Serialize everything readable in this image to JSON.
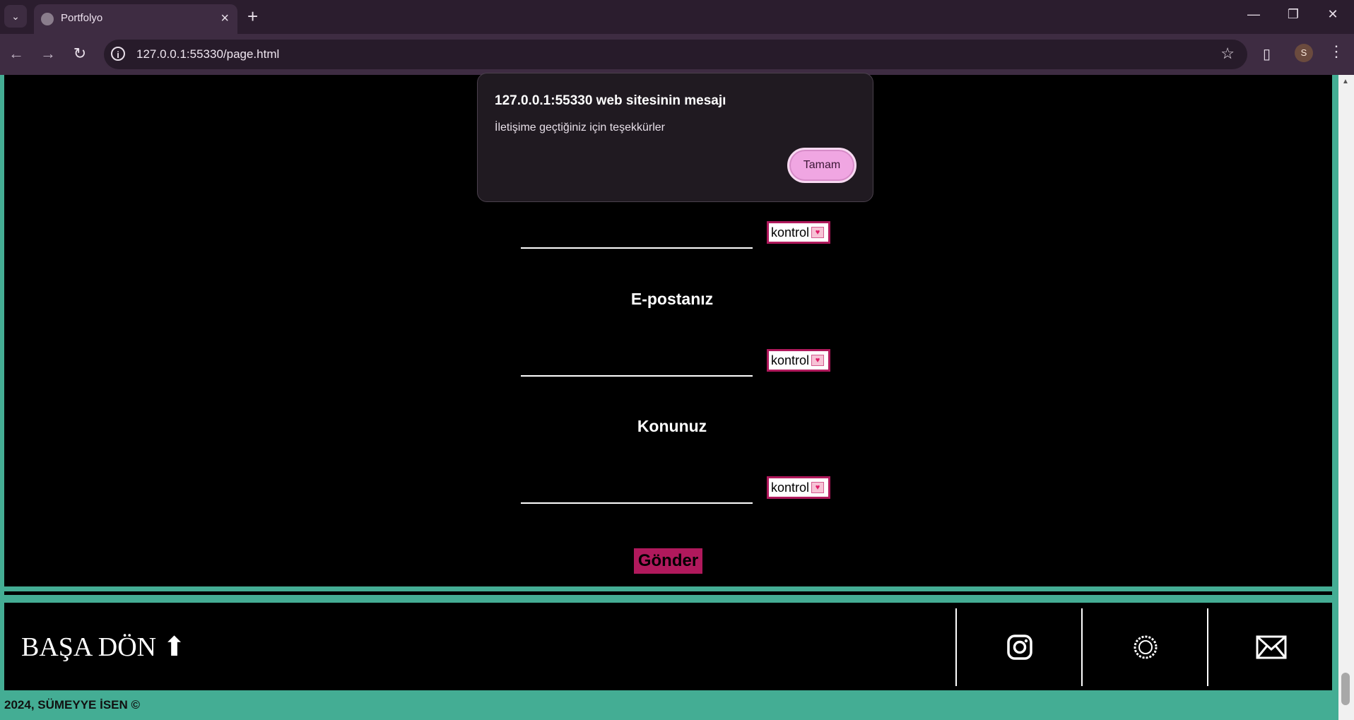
{
  "browser": {
    "tab_title": "Portfolyo",
    "url": "127.0.0.1:55330/page.html",
    "profile_initial": "S"
  },
  "form": {
    "fields": [
      {
        "label": "",
        "check_label": "kontrol"
      },
      {
        "label": "E-postanız",
        "check_label": "kontrol"
      },
      {
        "label": "Konunuz",
        "check_label": "kontrol"
      }
    ],
    "submit_label": "Gönder"
  },
  "footer": {
    "back_to_top": "BAŞA DÖN ⬆",
    "social": [
      "instagram-icon",
      "threads-icon",
      "mail-icon"
    ],
    "copyright": "2024, SÜMEYYE İSEN ©"
  },
  "dialog": {
    "title": "127.0.0.1:55330 web sitesinin mesajı",
    "message": "İletişime geçtiğiniz için teşekkürler",
    "ok_label": "Tamam"
  },
  "colors": {
    "accent_teal": "#44ad94",
    "accent_pink": "#b0195c",
    "dialog_button": "#f0a6e2"
  }
}
